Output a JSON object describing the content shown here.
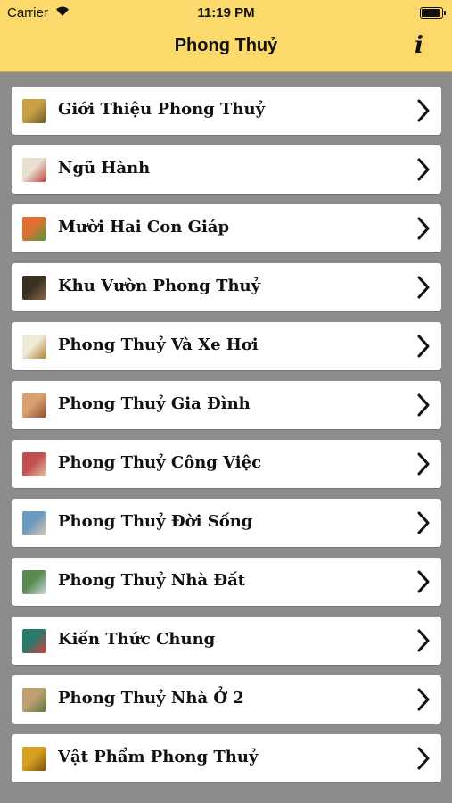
{
  "status_bar": {
    "carrier": "Carrier",
    "time": "11:19 PM"
  },
  "header": {
    "title": "Phong Thuỷ",
    "info_label": "i"
  },
  "menu": [
    {
      "label": "Giới Thiệu Phong Thuỷ",
      "icon": "dragon-statue-icon",
      "colors": [
        "#c9a045",
        "#6b5a2a"
      ]
    },
    {
      "label": "Ngũ Hành",
      "icon": "five-elements-chart-icon",
      "colors": [
        "#e8e0d0",
        "#c04040"
      ]
    },
    {
      "label": "Mười Hai Con Giáp",
      "icon": "zodiac-grid-icon",
      "colors": [
        "#e07030",
        "#4a9a40"
      ]
    },
    {
      "label": "Khu Vườn Phong Thuỷ",
      "icon": "garden-icon",
      "colors": [
        "#3a3020",
        "#8a6a50"
      ]
    },
    {
      "label": "Phong Thuỷ Và Xe Hơi",
      "icon": "car-lamp-icon",
      "colors": [
        "#f0ead8",
        "#b08030"
      ]
    },
    {
      "label": "Phong Thuỷ Gia Đình",
      "icon": "living-room-icon",
      "colors": [
        "#d9a070",
        "#8a5030"
      ]
    },
    {
      "label": "Phong Thuỷ Công Việc",
      "icon": "office-people-icon",
      "colors": [
        "#c05050",
        "#e8c0a0"
      ]
    },
    {
      "label": "Phong Thuỷ Đời Sống",
      "icon": "family-photo-icon",
      "colors": [
        "#6a9ac0",
        "#e0c8b0"
      ]
    },
    {
      "label": "Phong Thuỷ Nhà Đất",
      "icon": "house-icon",
      "colors": [
        "#5a8a50",
        "#d0d8e0"
      ]
    },
    {
      "label": "Kiến Thức Chung",
      "icon": "compass-icon",
      "colors": [
        "#2a7a6a",
        "#d04040"
      ]
    },
    {
      "label": "Phong Thuỷ Nhà Ở 2",
      "icon": "home-exterior-icon",
      "colors": [
        "#c0a070",
        "#5a7a40"
      ]
    },
    {
      "label": "Vật Phẩm Phong Thuỷ",
      "icon": "golden-toad-icon",
      "colors": [
        "#d8a020",
        "#7a5010"
      ]
    }
  ],
  "colors": {
    "header_bg": "#fbd96b",
    "page_bg": "#8c8c8c",
    "row_bg": "#ffffff"
  }
}
